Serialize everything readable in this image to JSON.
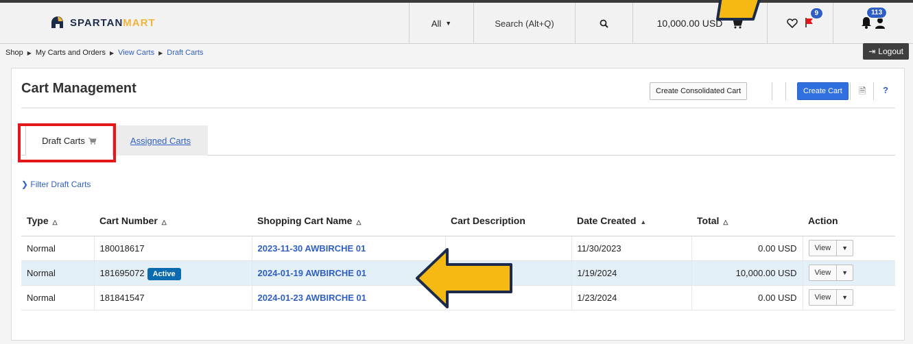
{
  "app": {
    "logo_text_main": "SPARTAN",
    "logo_text_accent": "MART"
  },
  "topbar": {
    "search_scope": "All",
    "search_placeholder": "Search (Alt+Q)",
    "cart_total": "10,000.00 USD",
    "flag_count": "9",
    "notification_count": "113"
  },
  "breadcrumb": {
    "items": [
      "Shop",
      "My Carts and Orders",
      "View Carts",
      "Draft Carts"
    ]
  },
  "logout_label": "Logout",
  "panel": {
    "title": "Cart Management",
    "create_consolidated_label": "Create Consolidated Cart",
    "create_cart_label": "Create Cart",
    "help_label": "?"
  },
  "tabs": {
    "draft": "Draft Carts",
    "assigned": "Assigned Carts"
  },
  "filter_label": "Filter Draft Carts",
  "table": {
    "headers": [
      "Type",
      "Cart Number",
      "Shopping Cart Name",
      "Cart Description",
      "Date Created",
      "Total",
      "Action"
    ],
    "rows": [
      {
        "type": "Normal",
        "cart_number": "180018617",
        "badge": "",
        "name": "2023-11-30 AWBIRCHE 01",
        "description": "",
        "date": "11/30/2023",
        "total": "0.00 USD",
        "action": "View"
      },
      {
        "type": "Normal",
        "cart_number": "181695072",
        "badge": "Active",
        "name": "2024-01-19 AWBIRCHE 01",
        "description": "",
        "date": "1/19/2024",
        "total": "10,000.00 USD",
        "action": "View"
      },
      {
        "type": "Normal",
        "cart_number": "181841547",
        "badge": "",
        "name": "2024-01-23 AWBIRCHE 01",
        "description": "",
        "date": "1/23/2024",
        "total": "0.00 USD",
        "action": "View"
      }
    ]
  },
  "colors": {
    "accent_blue": "#2f5fc4",
    "active_badge": "#0a6bb0",
    "highlight_red": "#e4161a",
    "arrow_fill": "#f6b913",
    "arrow_stroke": "#1c2b4a"
  }
}
